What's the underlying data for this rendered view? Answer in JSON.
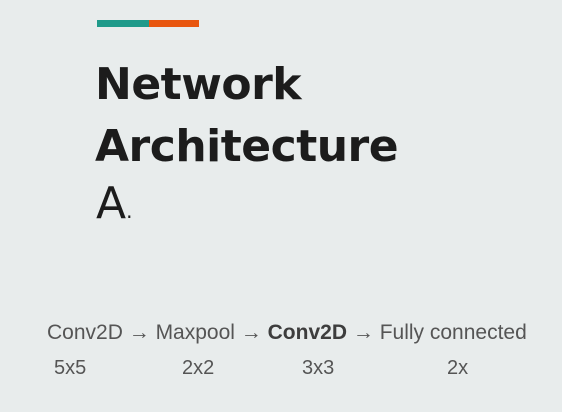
{
  "accent_colors": [
    "#1f9a8a",
    "#e8560f"
  ],
  "title_lines": [
    "Network",
    "Architecture"
  ],
  "subtitle": "A",
  "subtitle_suffix": ".",
  "pipeline": {
    "steps": [
      "Conv2D",
      "Maxpool",
      "Conv2D",
      "Fully connected"
    ],
    "arrow": "→",
    "highlighted_step": 2
  },
  "params": [
    "5x5",
    "2x2",
    "3x3",
    "2x"
  ]
}
